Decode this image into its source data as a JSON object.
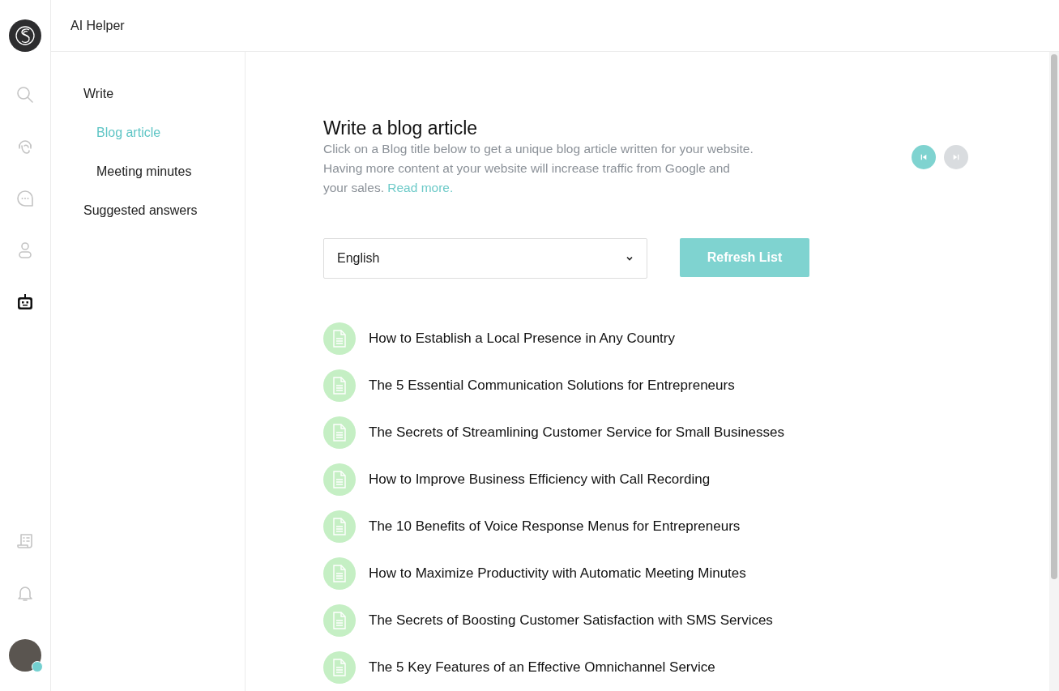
{
  "app": {
    "title": "AI Helper"
  },
  "rail": {
    "top": [
      {
        "kind": "search",
        "selected": false
      },
      {
        "kind": "headset",
        "selected": false
      },
      {
        "kind": "chat",
        "selected": false
      },
      {
        "kind": "person",
        "selected": false
      },
      {
        "kind": "robot",
        "selected": true
      }
    ],
    "bottom": [
      {
        "kind": "receipt",
        "selected": false
      },
      {
        "kind": "bell",
        "selected": false
      }
    ],
    "avatar": {
      "online": true
    }
  },
  "nav": {
    "items": [
      {
        "label": "Write",
        "selected": false,
        "children": [
          {
            "label": "Blog article",
            "selected": true
          },
          {
            "label": "Meeting minutes",
            "selected": false
          }
        ]
      },
      {
        "label": "Suggested answers",
        "selected": false
      }
    ]
  },
  "article": {
    "title": "Write a blog article",
    "description": "Click on a Blog title below to get a unique blog article written for your website. Having more content at your website will increase traffic from Google and your sales.",
    "read_more": "Read more.",
    "pager": {
      "previous": {
        "disabled": false
      },
      "next": {
        "disabled": true
      }
    },
    "language": {
      "value": "English"
    },
    "refresh_button": {
      "label": "Refresh List"
    },
    "titles": [
      "How to Establish a Local Presence in Any Country",
      "The 5 Essential Communication Solutions for Entrepreneurs",
      "The Secrets of Streamlining Customer Service for Small Businesses",
      "How to Improve Business Efficiency with Call Recording",
      "The 10 Benefits of Voice Response Menus for Entrepreneurs",
      "How to Maximize Productivity with Automatic Meeting Minutes",
      "The Secrets of Boosting Customer Satisfaction with SMS Services",
      "The 5 Key Features of an Effective Omnichannel Service"
    ]
  }
}
